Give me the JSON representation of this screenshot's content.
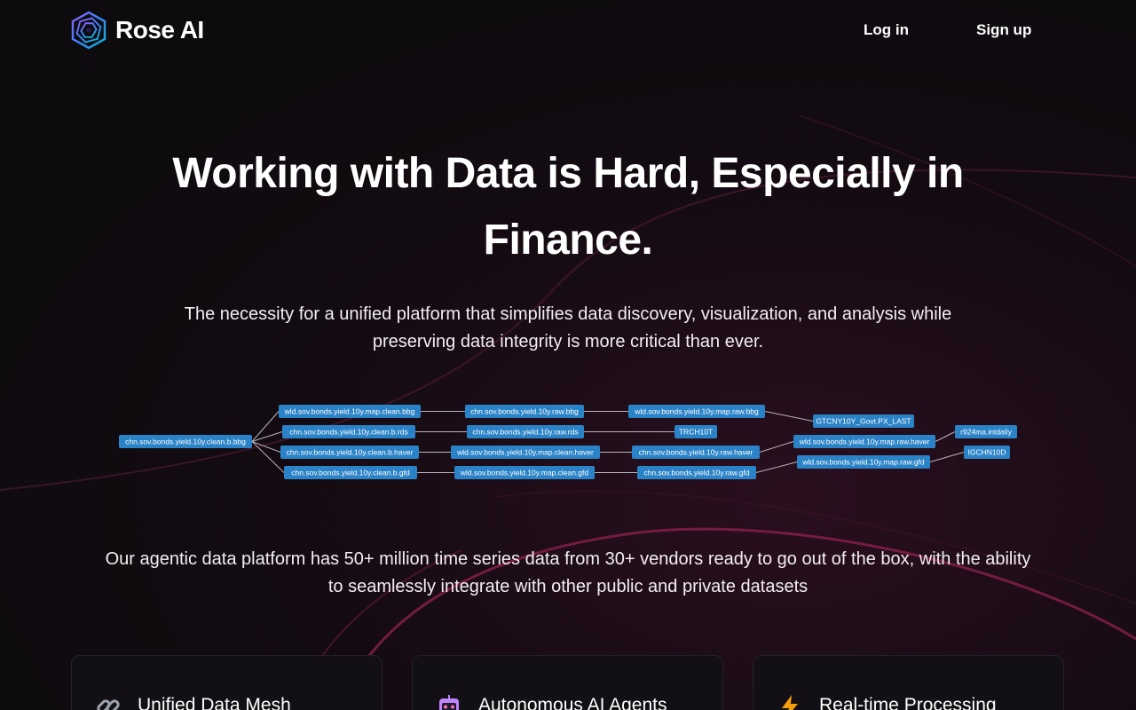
{
  "brand": {
    "name": "Rose AI",
    "logo_icon": "hexagon-spiral-logo"
  },
  "nav": {
    "login_label": "Log in",
    "signup_label": "Sign up"
  },
  "hero": {
    "title": "Working with Data is Hard, Especially in Finance.",
    "subtitle": "The necessity for a unified platform that simplifies data discovery, visualization, and analysis while preserving data integrity is more critical than ever."
  },
  "lineage_graph": {
    "nodes": [
      "chn.sov.bonds.yield.10y.clean.b.bbg",
      "wld.sov.bonds.yield.10y.map.clean.bbg",
      "chn.sov.bonds.yield.10y.clean.b.rds",
      "chn.sov.bonds.yield.10y.clean.b.haver",
      "chn.sov.bonds.yield.10y.clean.b.gfd",
      "chn.sov.bonds.yield.10y.raw.bbg",
      "chn.sov.bonds.yield.10y.raw.rds",
      "wld.sov.bonds.yield.10y.map.clean.haver",
      "wld.sov.bonds.yield.10y.map.clean.gfd",
      "wld.sov.bonds.yield.10y.map.raw.bbg",
      "TRCH10T",
      "chn.sov.bonds.yield.10y.raw.haver",
      "chn.sov.bonds.yield.10y.raw.gfd",
      "GTCNY10Y_Govt.PX_LAST",
      "wld.sov.bonds.yield.10y.map.raw.haver",
      "wld.sov.bonds.yield.10y.map.raw.gfd",
      "r924ma.intdaily",
      "IGCHN10D"
    ]
  },
  "middle": {
    "text": "Our agentic data platform has 50+ million time series data from 30+ vendors ready to go out of the box, with the ability to seamlessly integrate with other public and private datasets"
  },
  "features": [
    {
      "title": "Unified Data Mesh",
      "icon": "link-chain-icon"
    },
    {
      "title": "Autonomous AI Agents",
      "icon": "robot-icon"
    },
    {
      "title": "Real-time Processing",
      "icon": "lightning-icon"
    }
  ],
  "colors": {
    "node_fill": "#2b83c7",
    "accent_pink": "#c2185b",
    "background": "#0e0b0f"
  }
}
